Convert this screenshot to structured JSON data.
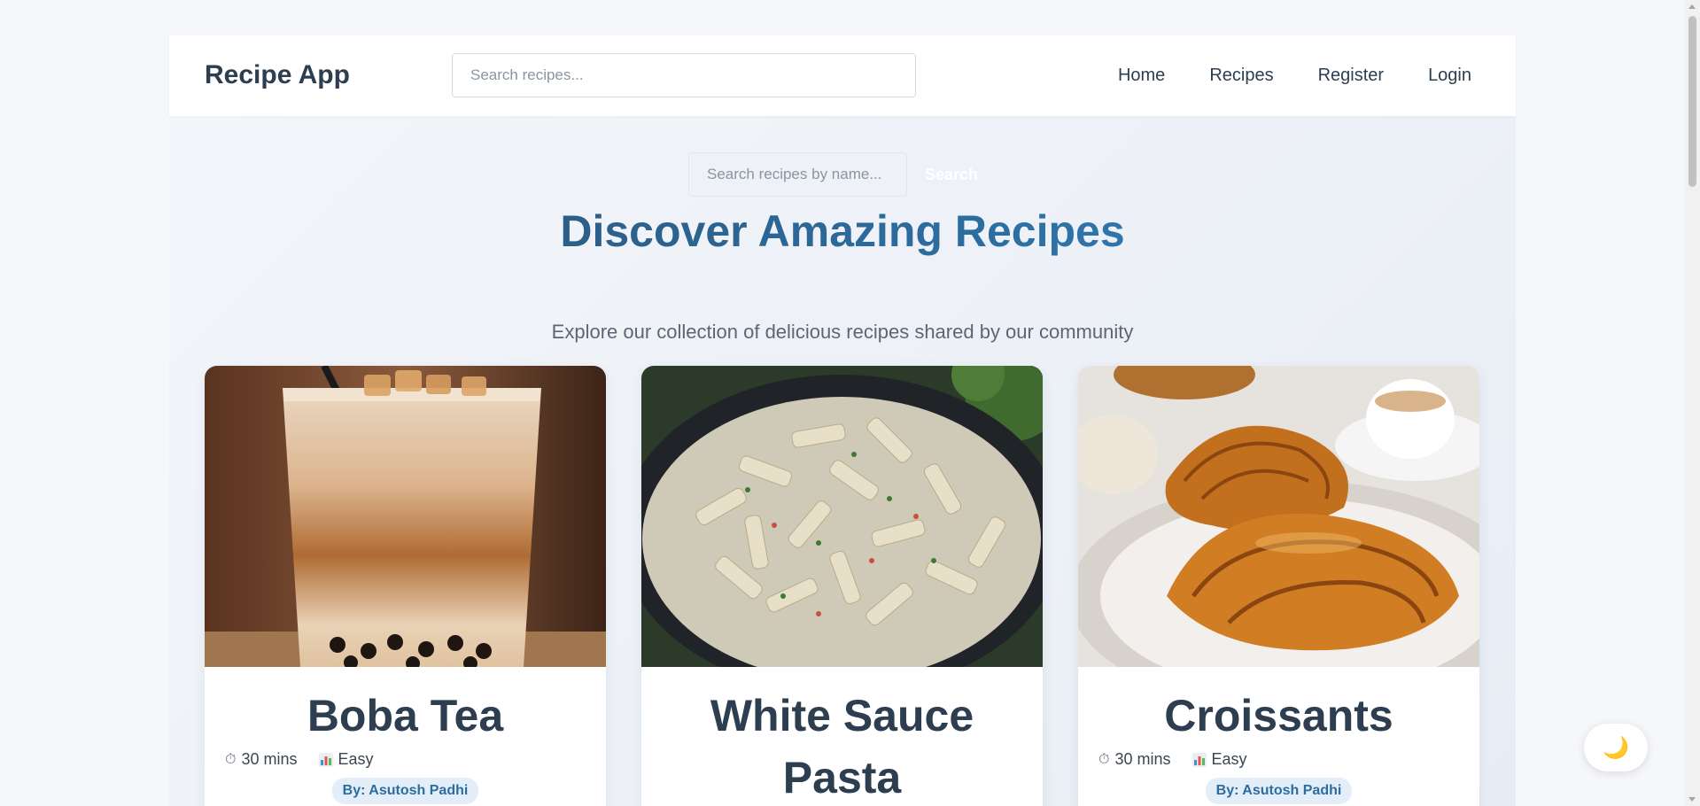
{
  "navbar": {
    "brand": "Recipe App",
    "search_placeholder": "Search recipes...",
    "links": [
      "Home",
      "Recipes",
      "Register",
      "Login"
    ]
  },
  "hero": {
    "search_placeholder": "Search recipes by name...",
    "search_button": "Search",
    "title": "Discover Amazing Recipes",
    "subtitle": "Explore our collection of delicious recipes shared by our community"
  },
  "recipes": [
    {
      "title": "Boba Tea",
      "time": "30 mins",
      "difficulty": "Easy",
      "author": "By: Asutosh Padhi",
      "time_icon": "timer-icon",
      "difficulty_icon": "chart-icon"
    },
    {
      "title": "White Sauce Pasta",
      "time": "",
      "difficulty": "",
      "author": ""
    },
    {
      "title": "Croissants",
      "time": "30 mins",
      "difficulty": "Easy",
      "author": "By: Asutosh Padhi",
      "time_icon": "timer-icon",
      "difficulty_icon": "chart-icon"
    }
  ],
  "icons": {
    "timer": "⏱",
    "theme_toggle": "🌙"
  },
  "colors": {
    "brand_text": "#2c3e50",
    "accent": "#2c6da0",
    "badge_bg": "#e4eef9"
  }
}
